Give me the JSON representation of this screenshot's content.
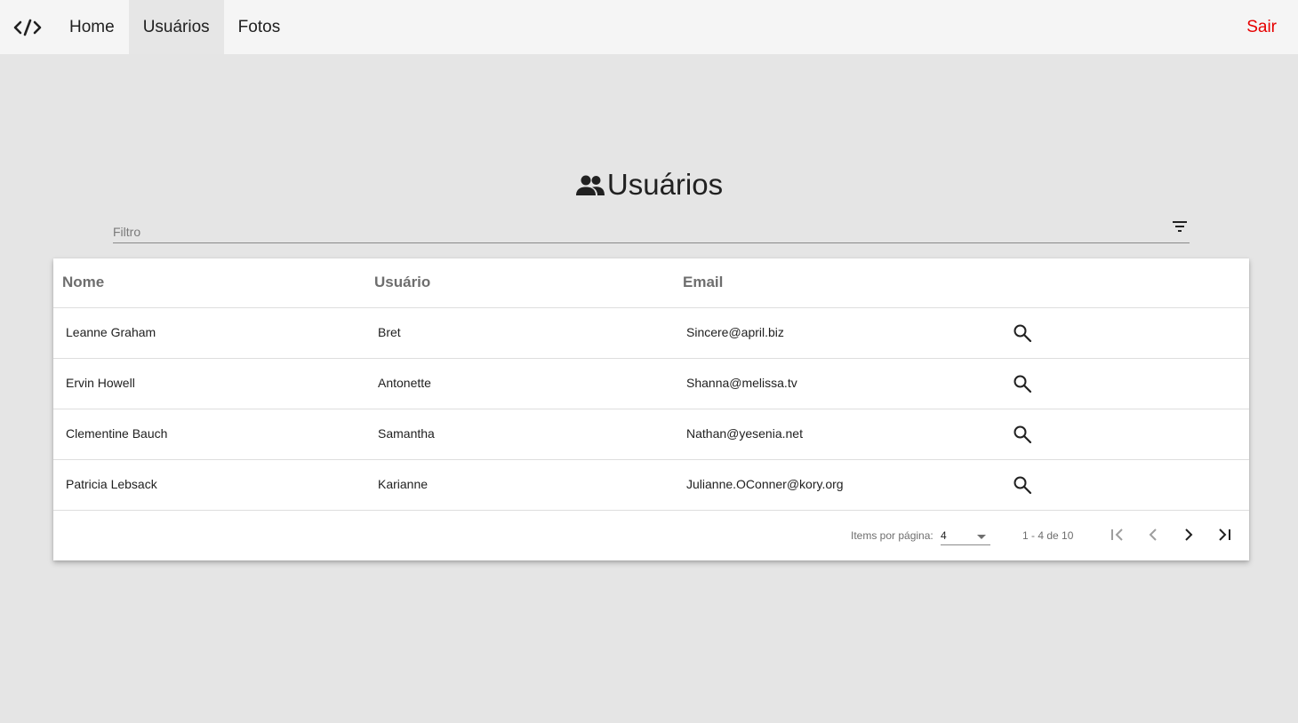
{
  "nav": {
    "logo_icon": "code-icon",
    "items": [
      {
        "label": "Home",
        "active": false
      },
      {
        "label": "Usuários",
        "active": true
      },
      {
        "label": "Fotos",
        "active": false
      }
    ],
    "logout_label": "Sair",
    "logout_color": "#e60000"
  },
  "page": {
    "title": "Usuários",
    "title_icon": "group-icon"
  },
  "filter": {
    "placeholder": "Filtro",
    "value": "",
    "icon": "filter-icon"
  },
  "table": {
    "columns": [
      "Nome",
      "Usuário",
      "Email"
    ],
    "rows": [
      {
        "nome": "Leanne Graham",
        "usuario": "Bret",
        "email": "Sincere@april.biz"
      },
      {
        "nome": "Ervin Howell",
        "usuario": "Antonette",
        "email": "Shanna@melissa.tv"
      },
      {
        "nome": "Clementine Bauch",
        "usuario": "Samantha",
        "email": "Nathan@yesenia.net"
      },
      {
        "nome": "Patricia Lebsack",
        "usuario": "Karianne",
        "email": "Julianne.OConner@kory.org"
      }
    ],
    "row_action_icon": "search-icon"
  },
  "paginator": {
    "items_label": "Items por página:",
    "page_size": "4",
    "range_label": "1 - 4 de 10",
    "first_icon": "first-page-icon",
    "prev_icon": "chevron-left-icon",
    "next_icon": "chevron-right-icon",
    "last_icon": "last-page-icon"
  }
}
